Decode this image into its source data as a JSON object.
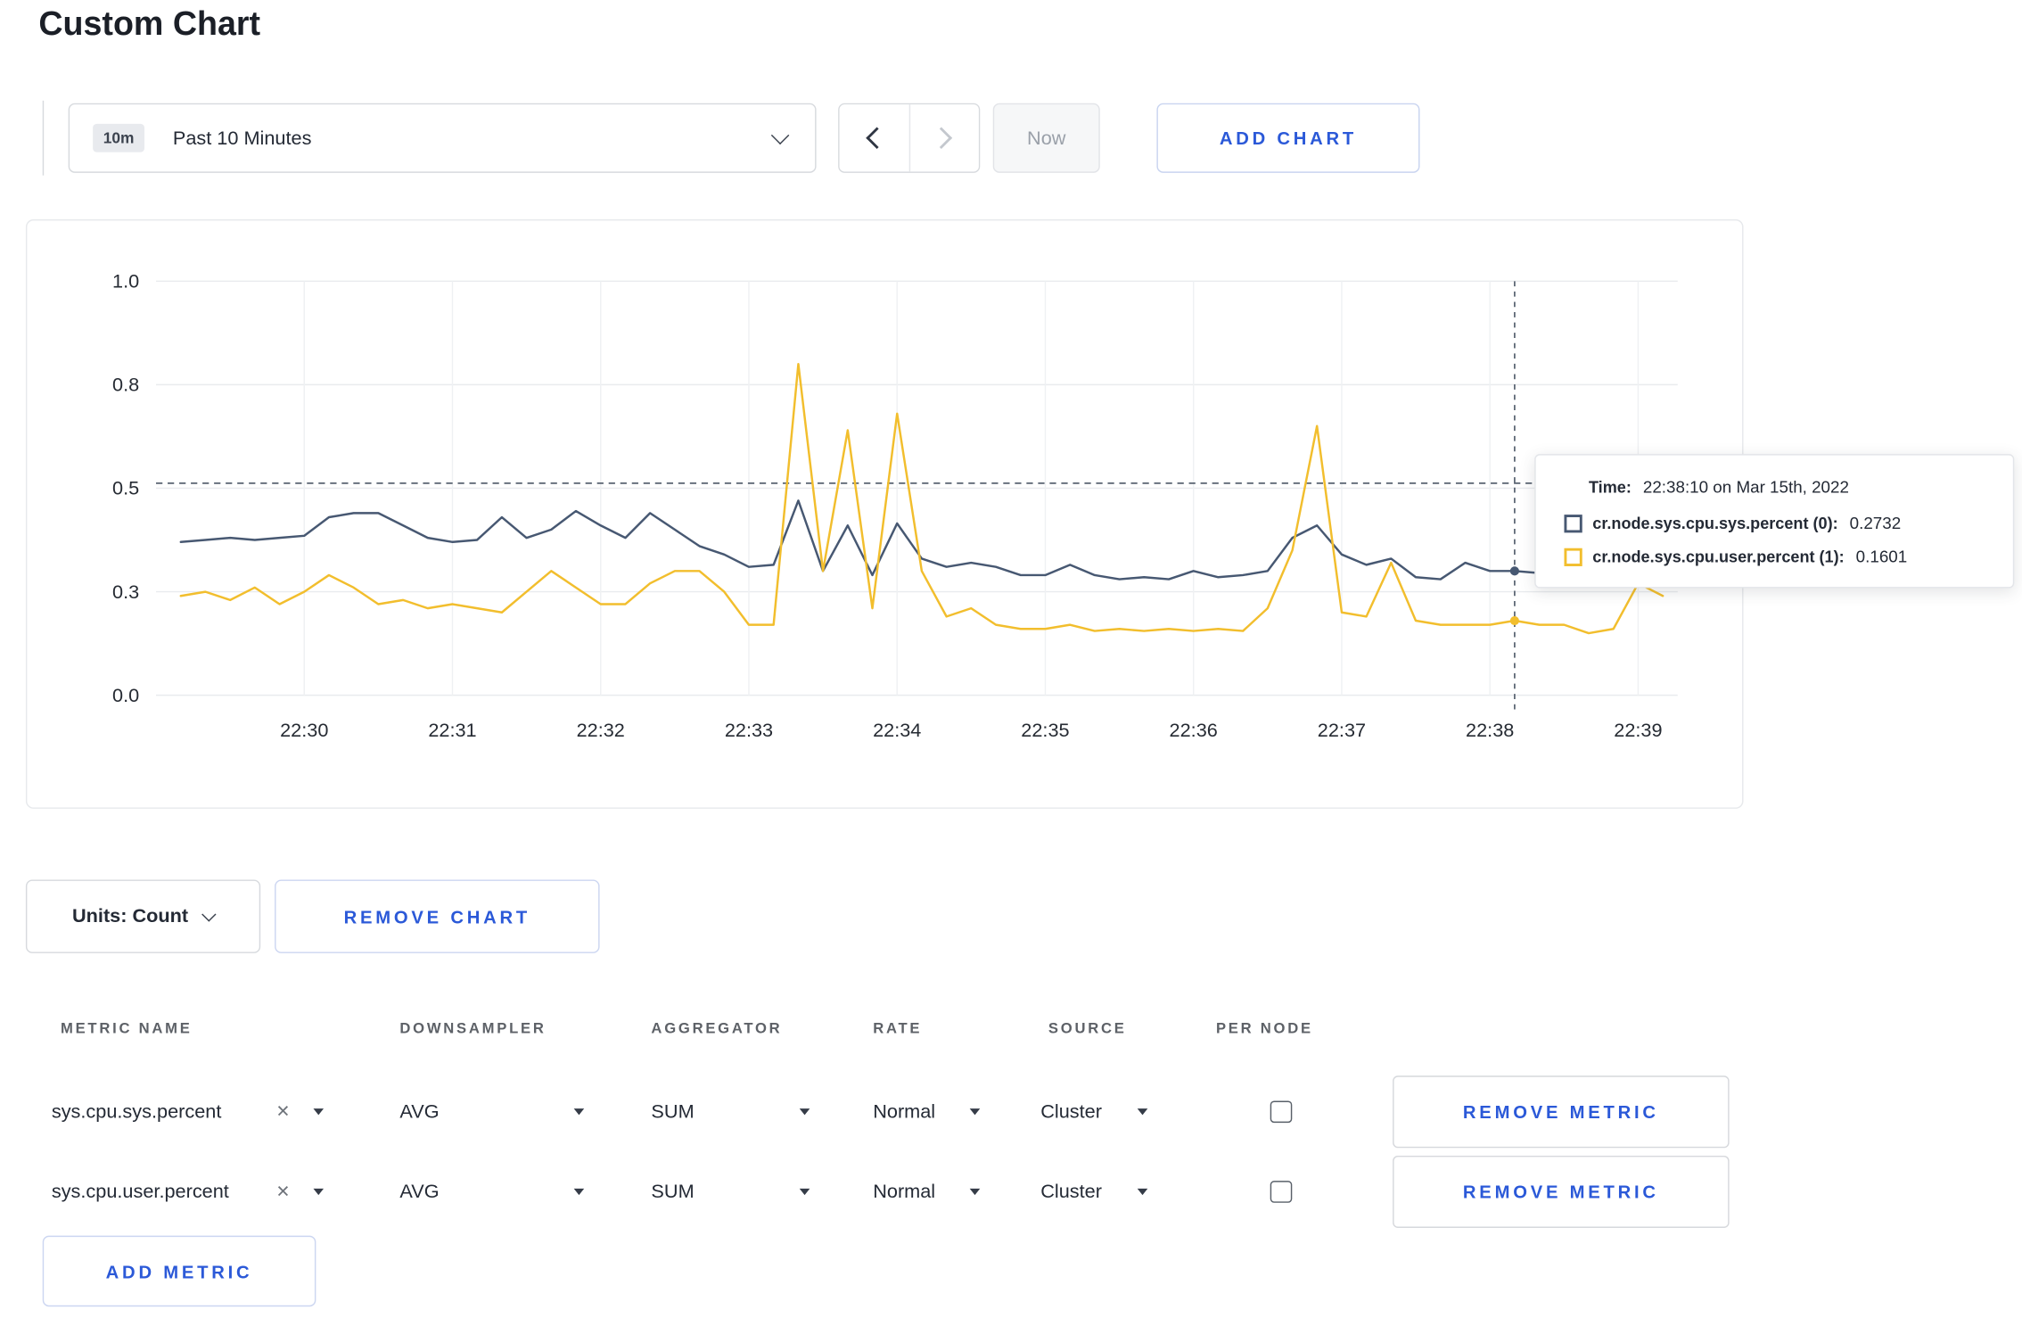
{
  "page": {
    "title": "Custom Chart"
  },
  "colors": {
    "accent": "#2b59d8",
    "series_sys": "#475872",
    "series_user": "#f2be2d",
    "text": "#242a35"
  },
  "icons": {
    "clear": "✕"
  },
  "toolbar": {
    "range_badge": "10m",
    "range_label": "Past 10 Minutes",
    "now_label": "Now",
    "add_chart_label": "ADD CHART"
  },
  "chart_data": {
    "type": "line",
    "title": "",
    "xlabel": "",
    "ylabel": "",
    "ylim": [
      0,
      1
    ],
    "grid": true,
    "x_domain_seconds": [
      0,
      616
    ],
    "x_ticks": [
      {
        "t": 60,
        "label": "22:30"
      },
      {
        "t": 120,
        "label": "22:31"
      },
      {
        "t": 180,
        "label": "22:32"
      },
      {
        "t": 240,
        "label": "22:33"
      },
      {
        "t": 300,
        "label": "22:34"
      },
      {
        "t": 360,
        "label": "22:35"
      },
      {
        "t": 420,
        "label": "22:36"
      },
      {
        "t": 480,
        "label": "22:37"
      },
      {
        "t": 540,
        "label": "22:38"
      },
      {
        "t": 600,
        "label": "22:39"
      }
    ],
    "y_ticks": [
      {
        "v": 0,
        "label": "0.0"
      },
      {
        "v": 0.25,
        "label": "0.3"
      },
      {
        "v": 0.5,
        "label": "0.5"
      },
      {
        "v": 0.75,
        "label": "0.8"
      },
      {
        "v": 1,
        "label": "1.0"
      }
    ],
    "threshold_line_v": 0.512,
    "crosshair": {
      "t": 550,
      "markers": [
        {
          "series": 0,
          "v": 0.3
        },
        {
          "series": 1,
          "v": 0.18
        }
      ]
    },
    "series": [
      {
        "name": "cr.node.sys.cpu.sys.percent",
        "color": "#475872",
        "points": [
          [
            10,
            0.37
          ],
          [
            20,
            0.375
          ],
          [
            30,
            0.38
          ],
          [
            40,
            0.375
          ],
          [
            50,
            0.38
          ],
          [
            60,
            0.385
          ],
          [
            70,
            0.43
          ],
          [
            80,
            0.44
          ],
          [
            90,
            0.44
          ],
          [
            100,
            0.41
          ],
          [
            110,
            0.38
          ],
          [
            120,
            0.37
          ],
          [
            130,
            0.375
          ],
          [
            140,
            0.43
          ],
          [
            150,
            0.38
          ],
          [
            160,
            0.4
          ],
          [
            170,
            0.445
          ],
          [
            180,
            0.41
          ],
          [
            190,
            0.38
          ],
          [
            200,
            0.44
          ],
          [
            210,
            0.4
          ],
          [
            220,
            0.36
          ],
          [
            230,
            0.34
          ],
          [
            240,
            0.31
          ],
          [
            250,
            0.315
          ],
          [
            260,
            0.47
          ],
          [
            270,
            0.3
          ],
          [
            280,
            0.41
          ],
          [
            290,
            0.29
          ],
          [
            300,
            0.415
          ],
          [
            310,
            0.33
          ],
          [
            320,
            0.31
          ],
          [
            330,
            0.32
          ],
          [
            340,
            0.31
          ],
          [
            350,
            0.29
          ],
          [
            360,
            0.29
          ],
          [
            370,
            0.315
          ],
          [
            380,
            0.29
          ],
          [
            390,
            0.28
          ],
          [
            400,
            0.285
          ],
          [
            410,
            0.28
          ],
          [
            420,
            0.3
          ],
          [
            430,
            0.285
          ],
          [
            440,
            0.29
          ],
          [
            450,
            0.3
          ],
          [
            460,
            0.38
          ],
          [
            470,
            0.41
          ],
          [
            480,
            0.34
          ],
          [
            490,
            0.315
          ],
          [
            500,
            0.33
          ],
          [
            510,
            0.285
          ],
          [
            520,
            0.28
          ],
          [
            530,
            0.32
          ],
          [
            540,
            0.3
          ],
          [
            550,
            0.3
          ],
          [
            560,
            0.295
          ],
          [
            570,
            0.3
          ],
          [
            580,
            0.31
          ],
          [
            590,
            0.3
          ],
          [
            600,
            0.3
          ],
          [
            610,
            0.31
          ]
        ]
      },
      {
        "name": "cr.node.sys.cpu.user.percent",
        "color": "#f2be2d",
        "points": [
          [
            10,
            0.24
          ],
          [
            20,
            0.25
          ],
          [
            30,
            0.23
          ],
          [
            40,
            0.26
          ],
          [
            50,
            0.22
          ],
          [
            60,
            0.25
          ],
          [
            70,
            0.29
          ],
          [
            80,
            0.26
          ],
          [
            90,
            0.22
          ],
          [
            100,
            0.23
          ],
          [
            110,
            0.21
          ],
          [
            120,
            0.22
          ],
          [
            130,
            0.21
          ],
          [
            140,
            0.2
          ],
          [
            150,
            0.25
          ],
          [
            160,
            0.3
          ],
          [
            170,
            0.26
          ],
          [
            180,
            0.22
          ],
          [
            190,
            0.22
          ],
          [
            200,
            0.27
          ],
          [
            210,
            0.3
          ],
          [
            220,
            0.3
          ],
          [
            230,
            0.25
          ],
          [
            240,
            0.17
          ],
          [
            250,
            0.17
          ],
          [
            260,
            0.8
          ],
          [
            270,
            0.3
          ],
          [
            280,
            0.64
          ],
          [
            290,
            0.21
          ],
          [
            300,
            0.68
          ],
          [
            310,
            0.3
          ],
          [
            320,
            0.19
          ],
          [
            330,
            0.21
          ],
          [
            340,
            0.17
          ],
          [
            350,
            0.16
          ],
          [
            360,
            0.16
          ],
          [
            370,
            0.17
          ],
          [
            380,
            0.155
          ],
          [
            390,
            0.16
          ],
          [
            400,
            0.155
          ],
          [
            410,
            0.16
          ],
          [
            420,
            0.155
          ],
          [
            430,
            0.16
          ],
          [
            440,
            0.155
          ],
          [
            450,
            0.21
          ],
          [
            460,
            0.35
          ],
          [
            470,
            0.65
          ],
          [
            480,
            0.2
          ],
          [
            490,
            0.19
          ],
          [
            500,
            0.32
          ],
          [
            510,
            0.18
          ],
          [
            520,
            0.17
          ],
          [
            530,
            0.17
          ],
          [
            540,
            0.17
          ],
          [
            550,
            0.18
          ],
          [
            560,
            0.17
          ],
          [
            570,
            0.17
          ],
          [
            580,
            0.15
          ],
          [
            590,
            0.16
          ],
          [
            600,
            0.27
          ],
          [
            610,
            0.24
          ]
        ]
      }
    ]
  },
  "tooltip": {
    "time_label": "Time:",
    "time_value": "22:38:10 on Mar 15th, 2022",
    "series": [
      {
        "label": "cr.node.sys.cpu.sys.percent (0):",
        "value": "0.2732"
      },
      {
        "label": "cr.node.sys.cpu.user.percent (1):",
        "value": "0.1601"
      }
    ]
  },
  "chart_controls": {
    "units_label": "Units: Count",
    "remove_chart_label": "REMOVE CHART"
  },
  "metrics_table": {
    "headers": [
      "METRIC NAME",
      "DOWNSAMPLER",
      "AGGREGATOR",
      "RATE",
      "SOURCE",
      "PER NODE"
    ],
    "rows": [
      {
        "metric": "sys.cpu.sys.percent",
        "downsampler": "AVG",
        "aggregator": "SUM",
        "rate": "Normal",
        "source": "Cluster",
        "per_node_checked": false,
        "remove_label": "REMOVE METRIC"
      },
      {
        "metric": "sys.cpu.user.percent",
        "downsampler": "AVG",
        "aggregator": "SUM",
        "rate": "Normal",
        "source": "Cluster",
        "per_node_checked": false,
        "remove_label": "REMOVE METRIC"
      }
    ],
    "add_metric_label": "ADD METRIC"
  }
}
